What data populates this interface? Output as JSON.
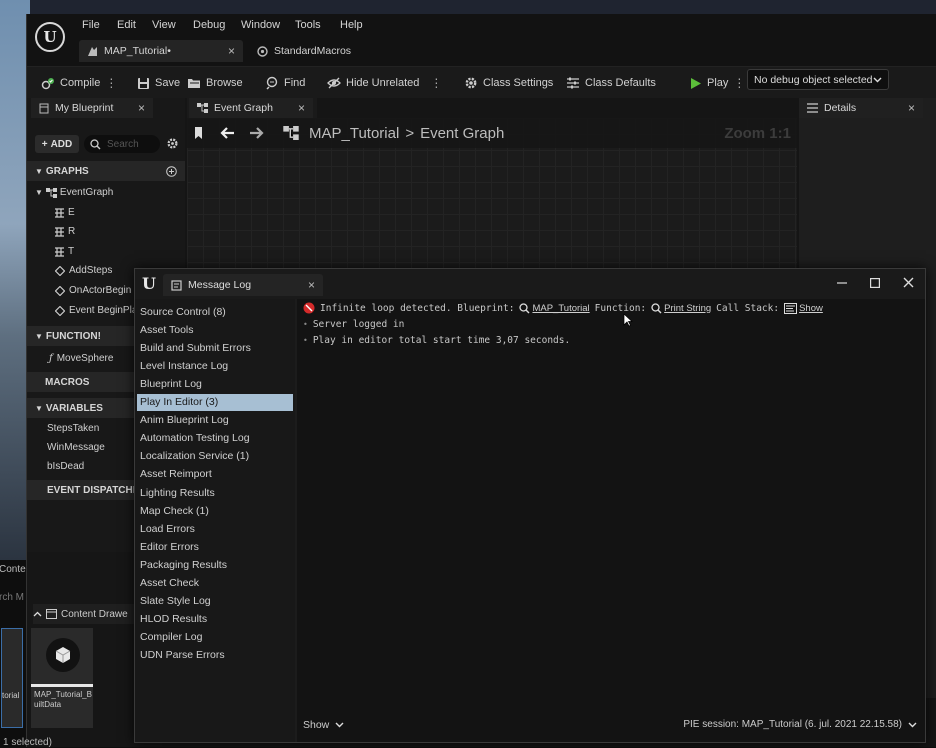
{
  "menu": [
    "File",
    "Edit",
    "View",
    "Debug",
    "Window",
    "Tools",
    "Help"
  ],
  "doc_tabs": [
    {
      "label": "MAP_Tutorial•",
      "close": "×"
    },
    {
      "label": "StandardMacros"
    }
  ],
  "toolbar": {
    "compile": "Compile",
    "save": "Save",
    "browse": "Browse",
    "find": "Find",
    "hide_unrelated": "Hide Unrelated",
    "class_settings": "Class Settings",
    "class_defaults": "Class Defaults",
    "play": "Play",
    "debug_select": "No debug object selected"
  },
  "panels": {
    "my_blueprint": "My Blueprint",
    "event_graph_tab": "Event Graph",
    "details": "Details",
    "close": "×"
  },
  "left_panel": {
    "add": "ADD",
    "search_placeholder": "Search",
    "graphs": "GRAPHS",
    "event_graph": "EventGraph",
    "graph_items": [
      "E",
      "R",
      "T",
      "AddSteps",
      "OnActorBegin",
      "Event BeginPla"
    ],
    "functions": "FUNCTION!",
    "function_items": [
      "MoveSphere"
    ],
    "macros": "MACROS",
    "variables": "VARIABLES",
    "variable_items": [
      {
        "name": "StepsTaken",
        "color": "#3fd29a"
      },
      {
        "name": "WinMessage",
        "color": "#e77fb0"
      },
      {
        "name": "bIsDead",
        "color": "#8b1010"
      }
    ],
    "event_dispatchers": "EVENT DISPATCHEI"
  },
  "graph": {
    "breadcrumb_root": "MAP_Tutorial",
    "breadcrumb_sep": ">",
    "breadcrumb_leaf": "Event Graph",
    "zoom": "Zoom 1:1"
  },
  "content": {
    "tab_partial": "Conte",
    "search_partial": "rch M",
    "drawer": "Content Drawe",
    "asset_left": "torial",
    "asset_name": "MAP_Tutorial_BuiltData",
    "selected": "1 selected)"
  },
  "message_log": {
    "title": "Message Log",
    "close": "×",
    "categories": [
      "Source Control (8)",
      "Asset Tools",
      "Build and Submit Errors",
      "Level Instance Log",
      "Blueprint Log",
      "Play In Editor (3)",
      "Anim Blueprint Log",
      "Automation Testing Log",
      "Localization Service (1)",
      "Asset Reimport",
      "Lighting Results",
      "Map Check (1)",
      "Load Errors",
      "Editor Errors",
      "Packaging Results",
      "Asset Check",
      "Slate Style Log",
      "HLOD Results",
      "Compiler Log",
      "UDN Parse Errors"
    ],
    "selected_index": 5,
    "error_line": {
      "prefix": "Infinite loop detected. Blueprint:",
      "blueprint_link": "MAP_Tutorial",
      "function_label": "Function:",
      "function_link": "Print String",
      "call_stack_label": "Call Stack:",
      "show_link": "Show"
    },
    "lines": [
      "Server logged in",
      "Play in editor total start time 3,07 seconds."
    ],
    "show_filter": "Show",
    "session": "PIE session: MAP_Tutorial (6. jul. 2021 22.15.58)"
  },
  "colors": {
    "accent_play": "#5cbf3a",
    "error": "#d42a2a",
    "selected": "#a7bfd3"
  }
}
